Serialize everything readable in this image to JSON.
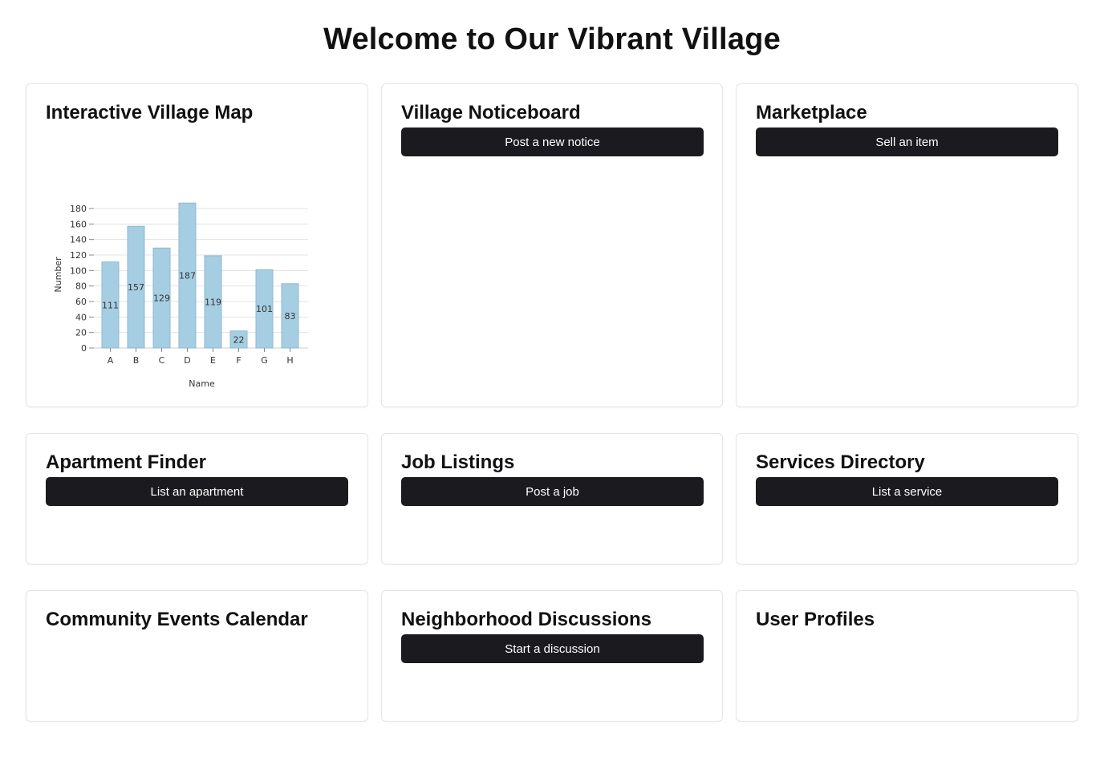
{
  "page": {
    "title": "Welcome to Our Vibrant Village"
  },
  "cards": {
    "map": {
      "title": "Interactive Village Map"
    },
    "noticeboard": {
      "title": "Village Noticeboard",
      "button": "Post a new notice"
    },
    "marketplace": {
      "title": "Marketplace",
      "button": "Sell an item"
    },
    "apartments": {
      "title": "Apartment Finder",
      "button": "List an apartment"
    },
    "jobs": {
      "title": "Job Listings",
      "button": "Post a job"
    },
    "services": {
      "title": "Services Directory",
      "button": "List a service"
    },
    "events": {
      "title": "Community Events Calendar"
    },
    "discussions": {
      "title": "Neighborhood Discussions",
      "button": "Start a discussion"
    },
    "profiles": {
      "title": "User Profiles"
    }
  },
  "chart_data": {
    "type": "bar",
    "categories": [
      "A",
      "B",
      "C",
      "D",
      "E",
      "F",
      "G",
      "H"
    ],
    "values": [
      111,
      157,
      129,
      187,
      119,
      22,
      101,
      83
    ],
    "xlabel": "Name",
    "ylabel": "Number",
    "ylim": [
      0,
      180
    ],
    "yticks": [
      0,
      20,
      40,
      60,
      80,
      100,
      120,
      140,
      160,
      180
    ],
    "grid": true,
    "bar_color": "#a6cee3",
    "bar_stroke": "#8fb8d0",
    "data_labels": true
  },
  "colors": {
    "button_bg": "#1b1b1f",
    "card_border": "#e4e4e7"
  }
}
